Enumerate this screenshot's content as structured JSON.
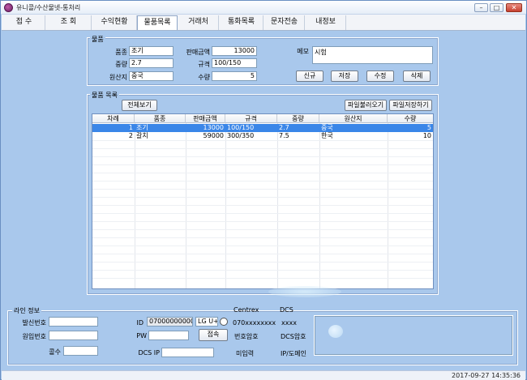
{
  "window": {
    "title": "유니콜/수산물넷-통처리"
  },
  "tabs": [
    "접 수",
    "조 회",
    "수익현황",
    "물품목록",
    "거래처",
    "통화목록",
    "문자전송",
    "내정보"
  ],
  "product_group": {
    "title": "물품",
    "name_label": "품종",
    "name_value": "조기",
    "weight_label": "중량",
    "weight_value": "2.7",
    "origin_label": "원산지",
    "origin_value": "중국",
    "price_label": "판매금액",
    "price_value": "13000",
    "spec_label": "규격",
    "spec_value": "100/150",
    "qty_label": "수량",
    "qty_value": "5",
    "memo_label": "메모",
    "memo_value": "시험",
    "new_button": "신규",
    "save_button": "저장",
    "edit_button": "수정",
    "delete_button": "삭제"
  },
  "list_group": {
    "title": "물품 목록",
    "view_all_button": "전체보기",
    "load_file_button": "파일불러오기",
    "save_file_button": "파일저장하기",
    "columns": [
      "차례",
      "품종",
      "판매금액",
      "규격",
      "중량",
      "원산지",
      "수량"
    ],
    "rows": [
      [
        "1",
        "조기",
        "13000",
        "100/150",
        "2.7",
        "중국",
        "5"
      ],
      [
        "2",
        "갈치",
        "59000",
        "300/350",
        "7.5",
        "한국",
        "10"
      ]
    ]
  },
  "line_info": {
    "title": "라인 정보",
    "caller_label": "발신번호",
    "caller_value": "",
    "origin_label": "원입번호",
    "origin_value": "",
    "count_label": "콜수",
    "count_value": "",
    "id_label": "ID",
    "id_value": "07000000000",
    "carrier": "LG U+",
    "pw_label": "PW",
    "pw_value": "",
    "connect_button": "접속",
    "dcsip_label": "DCS IP",
    "dcsip_value": "",
    "centrex_label": "Centrex",
    "centrex_value": "070xxxxxxxx",
    "dcs_label": "DCS",
    "dcs_value": "xxxx",
    "num_pw_label": "번호암호",
    "dcs_pw_label": "DCS암호",
    "not_input_label": "미입력",
    "ip_domain_label": "IP/도메인"
  },
  "status": {
    "datetime": "2017-09-27 14:35:36"
  }
}
